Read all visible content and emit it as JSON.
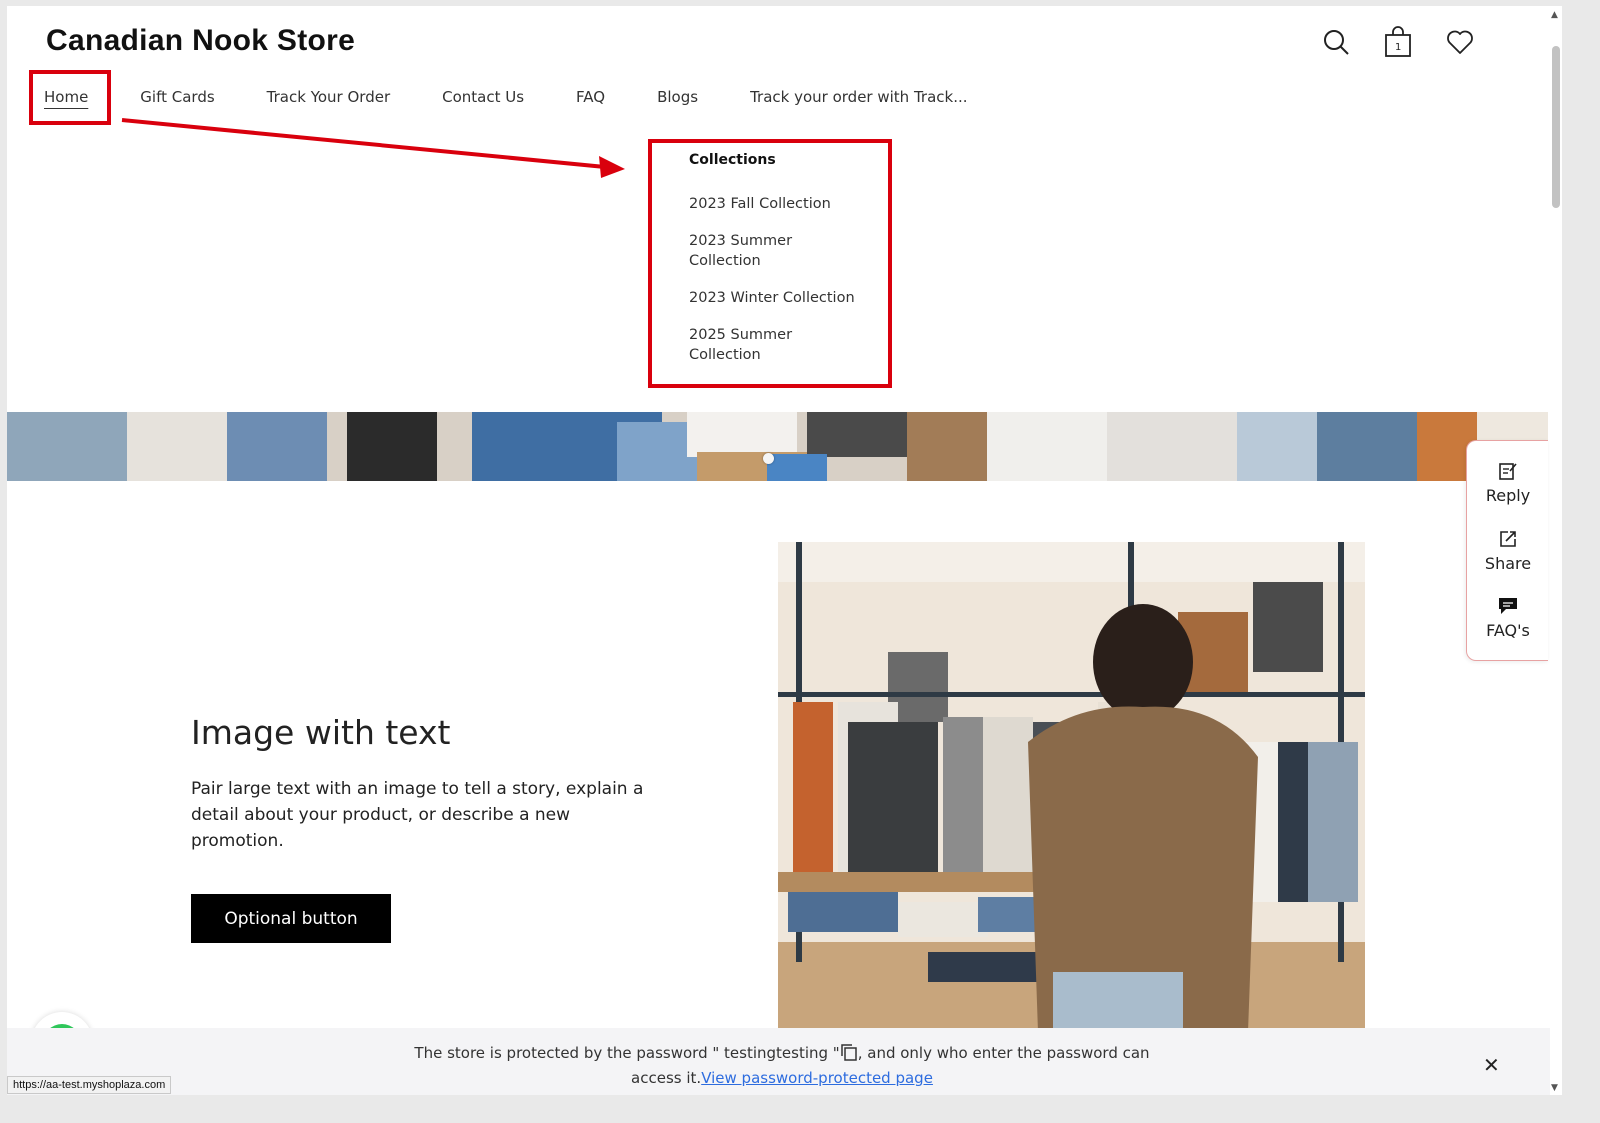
{
  "header": {
    "store_name": "Canadian Nook Store",
    "cart_count": "1",
    "icons": [
      "search-icon",
      "cart-icon",
      "heart-icon"
    ]
  },
  "nav": {
    "items": [
      "Home",
      "Gift Cards",
      "Track Your Order",
      "Contact Us",
      "FAQ",
      "Blogs",
      "Track your order with Track..."
    ]
  },
  "dropdown": {
    "heading": "Collections",
    "items": [
      "2023 Fall Collection",
      "2023 Summer Collection",
      "2023 Winter Collection",
      "2025 Summer Collection"
    ]
  },
  "image_with_text": {
    "title": "Image with text",
    "body": "Pair large text with an image to tell a story, explain a detail about your product, or describe a new promotion.",
    "button": "Optional button"
  },
  "side_widget": {
    "reply": "Reply",
    "share": "Share",
    "faqs": "FAQ's"
  },
  "notice": {
    "text_before": "The store is protected by the password \" testingtesting \"",
    "text_after": ", and only who enter the password can access it.",
    "link": "View password-protected page"
  },
  "status_url": "https://aa-test.myshoplaza.com",
  "colors": {
    "annotation_red": "#d9000d",
    "button_black": "#000000",
    "link_blue": "#2d6cdf"
  }
}
